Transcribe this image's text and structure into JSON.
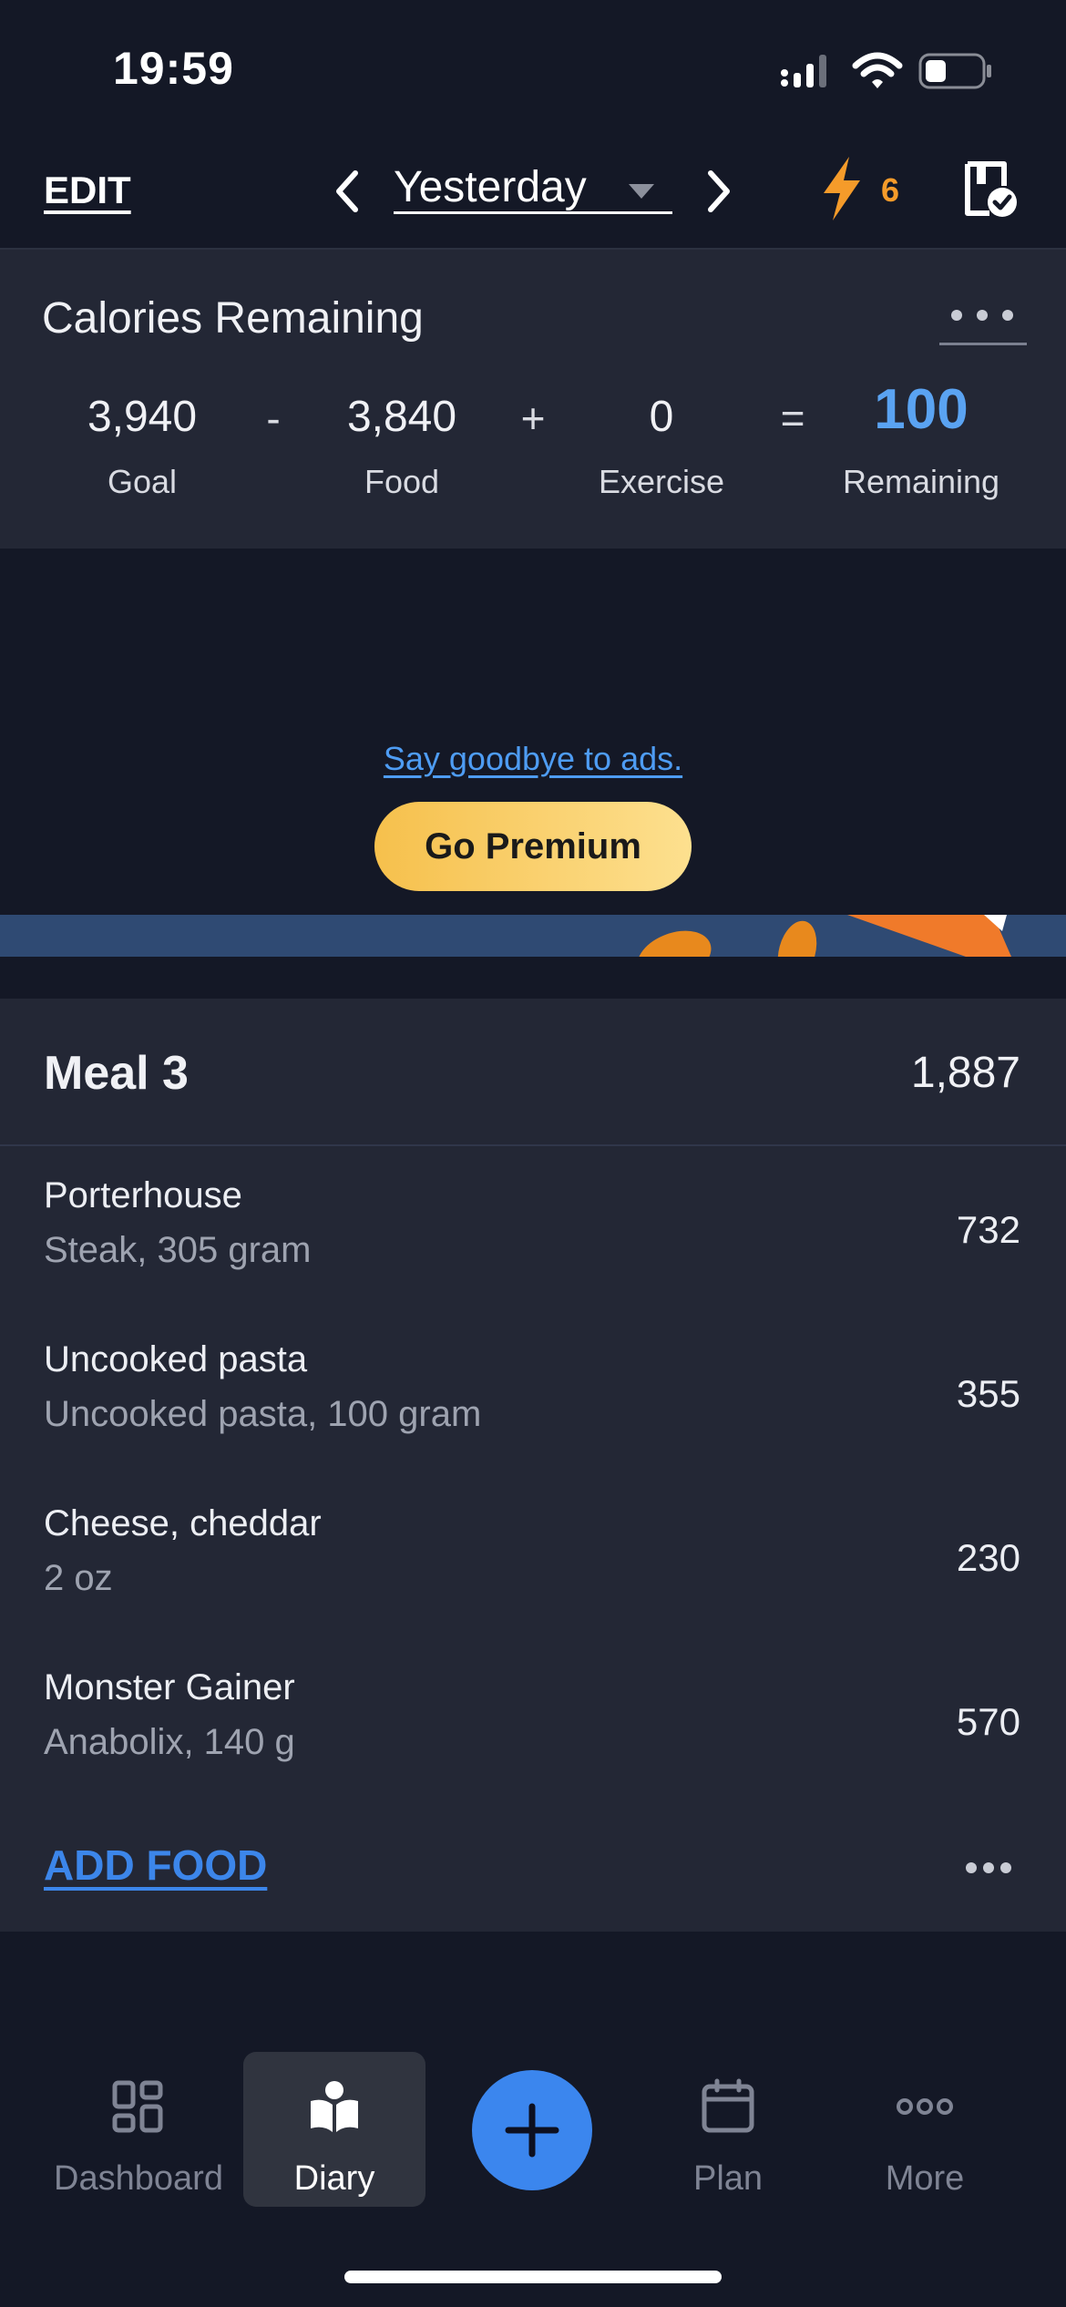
{
  "status_bar": {
    "time": "19:59"
  },
  "header": {
    "edit_label": "EDIT",
    "date_label": "Yesterday",
    "streak_count": "6",
    "colors": {
      "accent": "#f59b2a"
    }
  },
  "calories": {
    "title": "Calories Remaining",
    "goal": {
      "value": "3,940",
      "label": "Goal"
    },
    "op_minus": "-",
    "food": {
      "value": "3,840",
      "label": "Food"
    },
    "op_plus": "+",
    "exercise": {
      "value": "0",
      "label": "Exercise"
    },
    "op_equals": "=",
    "remaining": {
      "value": "100",
      "label": "Remaining"
    },
    "colors": {
      "remaining": "#5aa3f2"
    }
  },
  "ad": {
    "link_text": "Say goodbye to ads.",
    "button_label": "Go Premium"
  },
  "meal": {
    "title": "Meal 3",
    "total": "1,887",
    "items": [
      {
        "name": "Porterhouse",
        "desc": "Steak, 305 gram",
        "calories": "732"
      },
      {
        "name": "Uncooked pasta",
        "desc": "Uncooked pasta, 100 gram",
        "calories": "355"
      },
      {
        "name": "Cheese, cheddar",
        "desc": "2 oz",
        "calories": "230"
      },
      {
        "name": "Monster Gainer",
        "desc": "Anabolix, 140 g",
        "calories": "570"
      }
    ],
    "add_food_label": "ADD FOOD"
  },
  "nav": {
    "items": [
      {
        "label": "Dashboard",
        "icon": "dashboard-icon"
      },
      {
        "label": "Diary",
        "icon": "diary-icon",
        "active": true
      },
      {
        "label": "Plan",
        "icon": "calendar-icon"
      },
      {
        "label": "More",
        "icon": "more-icon"
      }
    ],
    "fab_icon": "plus-icon",
    "colors": {
      "fab": "#3b86ee"
    }
  }
}
